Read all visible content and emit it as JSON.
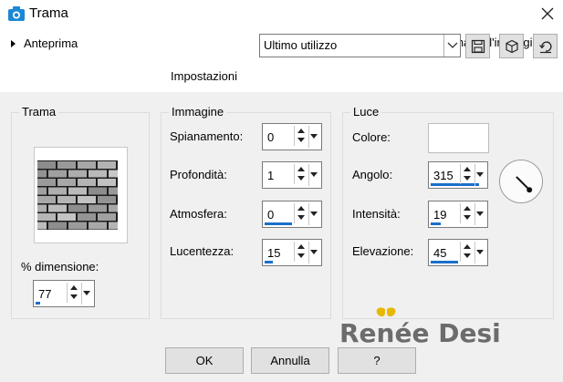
{
  "window": {
    "title": "Trama"
  },
  "top": {
    "preview_toggle": "Anteprima",
    "preview_image_label": "Anteprima dell'immagine",
    "preview_image_checked": true,
    "settings_label": "Impostazioni",
    "settings_value": "Ultimo utilizzo"
  },
  "groups": {
    "trama": {
      "title": "Trama",
      "size_label": "% dimensione:",
      "size_value": "77",
      "size_fraction": 0.08
    },
    "immagine": {
      "title": "Immagine",
      "fields": [
        {
          "label": "Spianamento:",
          "value": "0",
          "fraction": 0.0
        },
        {
          "label": "Profondità:",
          "value": "1",
          "fraction": 0.0
        },
        {
          "label": "Atmosfera:",
          "value": "0",
          "fraction": 0.5
        },
        {
          "label": "Lucentezza:",
          "value": "15",
          "fraction": 0.15
        }
      ]
    },
    "luce": {
      "title": "Luce",
      "color_label": "Colore:",
      "color_value": "#ffffff",
      "angle_label": "Angolo:",
      "angle_value": "315",
      "angle_fraction": 0.88,
      "intensity_label": "Intensità:",
      "intensity_value": "19",
      "intensity_fraction": 0.19,
      "elevation_label": "Elevazione:",
      "elevation_value": "45",
      "elevation_fraction": 0.5
    }
  },
  "watermark": {
    "text": "Renée Design"
  },
  "buttons": {
    "ok": "OK",
    "cancel": "Annulla",
    "help": "?"
  },
  "colors": {
    "accent": "#1a6fc9",
    "title_icon": "#1b87d6"
  }
}
